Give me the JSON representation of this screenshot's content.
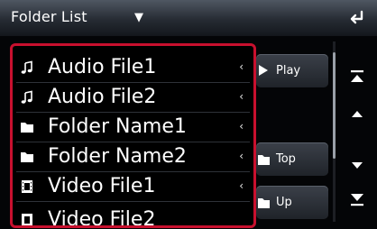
{
  "header": {
    "title": "Folder List"
  },
  "list": {
    "items": [
      {
        "type": "audio",
        "label": "Audio File1"
      },
      {
        "type": "audio",
        "label": "Audio File2"
      },
      {
        "type": "folder",
        "label": "Folder Name1"
      },
      {
        "type": "folder",
        "label": "Folder Name2"
      },
      {
        "type": "video",
        "label": "Video File1"
      },
      {
        "type": "video",
        "label": "Video File2"
      }
    ],
    "chevron": "‹"
  },
  "buttons": {
    "play": "Play",
    "top": "Top",
    "up": "Up"
  },
  "icons": {
    "audio": "music-note-icon",
    "folder": "folder-icon",
    "video": "video-icon",
    "back": "back-arrow-icon",
    "scroll_top": "scroll-to-top-icon",
    "page_up": "page-up-icon",
    "page_down": "page-down-icon",
    "scroll_bottom": "scroll-to-bottom-icon"
  },
  "colors": {
    "selection_border": "#c8102e",
    "header_bg": "#3a414b"
  }
}
